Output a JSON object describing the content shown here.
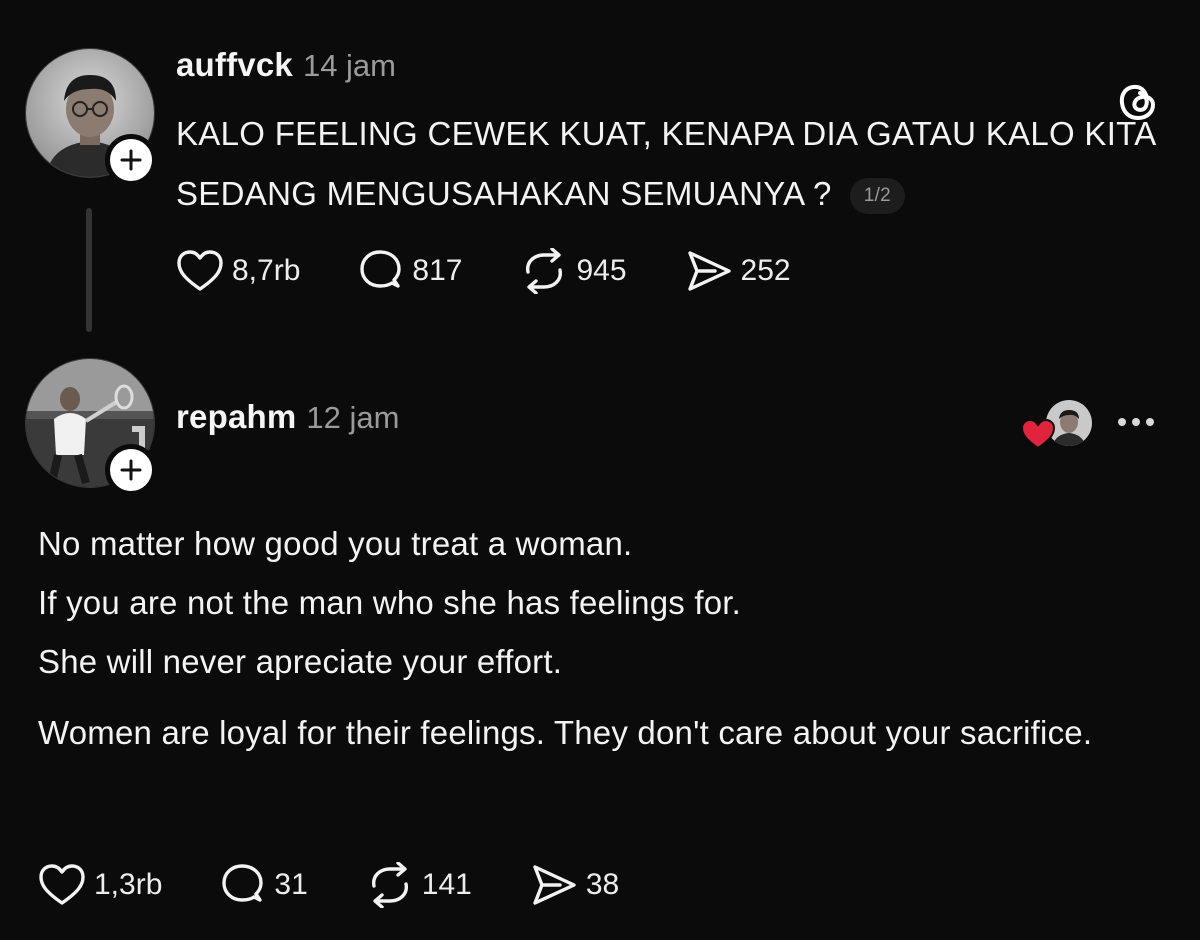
{
  "post": {
    "username": "auffvck",
    "time": "14 jam",
    "text": "KALO FEELING CEWEK KUAT, KENAPA DIA GATAU KALO KITA SEDANG MENGUSAHAKAN SEMUANYA ?",
    "pager": "1/2",
    "likes": "8,7rb",
    "replies": "817",
    "reposts": "945",
    "shares": "252"
  },
  "reply": {
    "username": "repahm",
    "time": "12 jam",
    "paragraphs": [
      "No matter how good you treat a woman.",
      "If you are not the man who she has feelings for.",
      "She will never apreciate your effort.",
      "Women are loyal for their feelings. They don't care about your sacrifice."
    ],
    "likes": "1,3rb",
    "replies": "31",
    "reposts": "141",
    "shares": "38"
  },
  "icons": {
    "app_logo": "threads-logo",
    "like": "heart-icon",
    "reply": "comment-icon",
    "repost": "repost-icon",
    "share": "send-icon",
    "more": "more-icon",
    "liked_by_author": "red-heart-icon"
  },
  "colors": {
    "background": "#0b0b0b",
    "text": "#f3f3f3",
    "muted": "#9a9a9a",
    "heart_red": "#e0243b"
  }
}
